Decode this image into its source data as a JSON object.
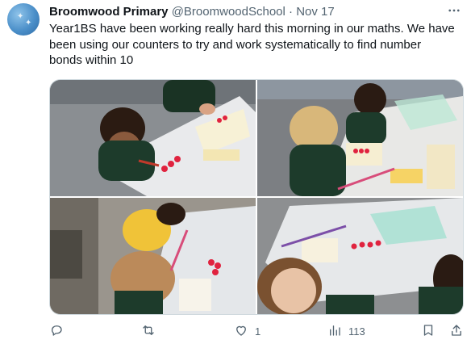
{
  "tweet": {
    "author_name": "Broomwood Primary",
    "handle": "@BroomwoodSchool",
    "separator": "·",
    "date": "Nov 17",
    "text": "Year1BS have been working really hard this morning in our maths. We have been using our counters to try and work systematically to find number bonds within 10"
  },
  "media": {
    "photos": [
      {
        "label": "children-at-desk-with-counters-1"
      },
      {
        "label": "children-at-desk-with-counters-2"
      },
      {
        "label": "children-at-desk-with-counters-3"
      },
      {
        "label": "children-at-desk-with-counters-4"
      }
    ]
  },
  "actions": {
    "reply": {
      "icon": "reply-icon",
      "count": ""
    },
    "retweet": {
      "icon": "retweet-icon",
      "count": ""
    },
    "like": {
      "icon": "heart-icon",
      "count": "1"
    },
    "views": {
      "icon": "analytics-icon",
      "count": "113"
    },
    "bookmark": {
      "icon": "bookmark-icon",
      "count": ""
    },
    "share": {
      "icon": "share-icon",
      "count": ""
    }
  },
  "colors": {
    "text": "#0f1419",
    "secondary": "#536471",
    "border": "#cfd9de",
    "counter_red": "#e0233f"
  }
}
